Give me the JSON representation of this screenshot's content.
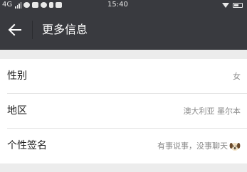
{
  "status_bar": {
    "network": "4G",
    "time": "15:40"
  },
  "header": {
    "title": "更多信息"
  },
  "rows": [
    {
      "label": "性别",
      "value": "女"
    },
    {
      "label": "地区",
      "value": "澳大利亚 墨尔本"
    },
    {
      "label": "个性签名",
      "value": "有事说事，没事聊天",
      "emoji_icon": "dog-face-icon"
    }
  ],
  "colors": {
    "app_bar": "#393a3f",
    "background": "#ececec",
    "card": "#ffffff",
    "label_text": "#1c1c1c",
    "value_text": "#8a8a8a"
  }
}
